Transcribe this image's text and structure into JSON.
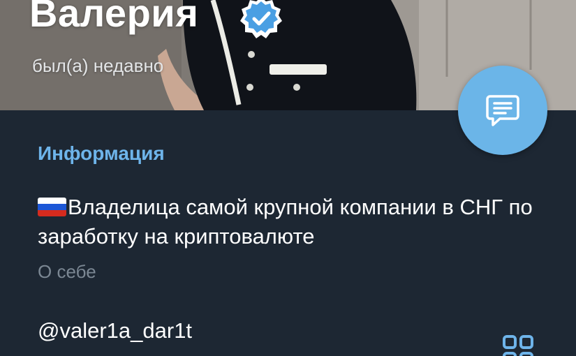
{
  "profile": {
    "name": "Валерия",
    "status": "был(а) недавно",
    "verified_icon": "verified-badge-icon"
  },
  "actions": {
    "message_icon": "message-icon",
    "qr_icon": "qr-code-icon"
  },
  "info": {
    "section_title": "Информация",
    "bio_flag_icon": "russia-flag-icon",
    "bio": "Владелица самой крупной компании в СНГ по заработку на криптовалюте",
    "bio_label": "О себе",
    "username": "@valer1a_dar1t"
  },
  "colors": {
    "background": "#1d2733",
    "accent": "#6eb4ea",
    "fab": "#6bb5e8",
    "verified": "#4a9fe3",
    "secondary_text": "#7b8793"
  }
}
